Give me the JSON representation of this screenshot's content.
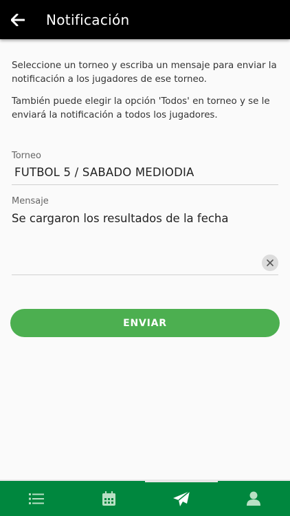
{
  "header": {
    "title": "Notificación",
    "background": "#000000",
    "back_icon": "arrow-left-icon"
  },
  "intro": {
    "paragraph_1": "Seleccione un torneo y escriba un mensaje para enviar la notificación a los jugadores de ese torneo.",
    "paragraph_2": "También puede elegir la opción 'Todos' en torneo y se le enviará la notificación a todos los jugadores."
  },
  "form": {
    "torneo_label": "Torneo",
    "torneo_value": "FUTBOL 5 / SABADO MEDIODIA",
    "mensaje_label": "Mensaje",
    "mensaje_value": "Se cargaron los resultados de la fecha",
    "clear_icon": "close-icon"
  },
  "actions": {
    "send_label": "ENVIAR",
    "send_color": "#4caf50"
  },
  "bottom_nav": {
    "background": "#00873e",
    "items": [
      {
        "icon": "list-icon",
        "active": false
      },
      {
        "icon": "calendar-icon",
        "active": false
      },
      {
        "icon": "send-icon",
        "active": true
      },
      {
        "icon": "user-icon",
        "active": false
      }
    ]
  }
}
